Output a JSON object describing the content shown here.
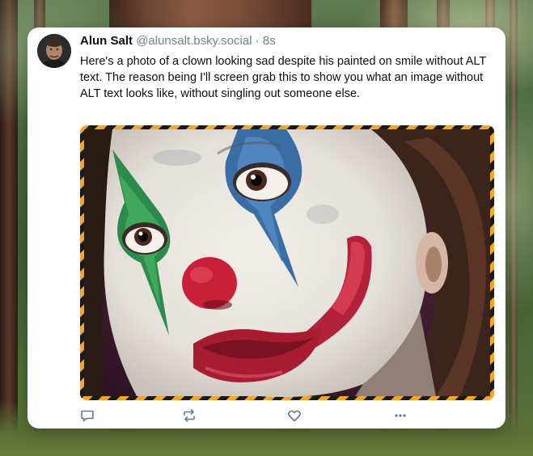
{
  "background": {
    "description_icon": "forest-background"
  },
  "post": {
    "author": {
      "name": "Alun Salt",
      "handle": "@alunsalt.bsky.social",
      "separator": " · ",
      "timestamp": "8s",
      "avatar_icon": "profile-avatar"
    },
    "text": "Here's a photo of a clown looking sad despite his painted on smile without ALT text. The reason being I'll screen grab this to show you what an image without ALT text looks like, without singling out someone else.",
    "image": {
      "alt": "",
      "border_colors": [
        "#f6a623",
        "#1a1a1a"
      ]
    },
    "actions": [
      {
        "name": "reply",
        "icon": "reply-icon"
      },
      {
        "name": "repost",
        "icon": "repost-icon"
      },
      {
        "name": "like",
        "icon": "heart-icon"
      },
      {
        "name": "more",
        "icon": "more-options-icon"
      }
    ]
  },
  "colors": {
    "text_primary": "#0b0f14",
    "text_secondary": "#6f8196",
    "card_bg": "#ffffff",
    "icon": "#5b7a98"
  }
}
